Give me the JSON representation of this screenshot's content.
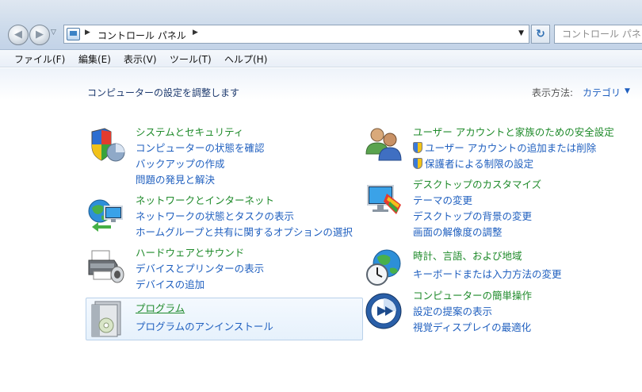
{
  "address_bar": {
    "path": [
      "コントロール パネル"
    ],
    "search_placeholder": "コントロール パネ"
  },
  "menu": [
    "ファイル(F)",
    "編集(E)",
    "表示(V)",
    "ツール(T)",
    "ヘルプ(H)"
  ],
  "header": {
    "title": "コンピューターの設定を調整します",
    "view_label": "表示方法:",
    "view_value": "カテゴリ"
  },
  "left_groups": [
    {
      "icon": "shield-icon",
      "title": "システムとセキュリティ",
      "links": [
        "コンピューターの状態を確認",
        "バックアップの作成",
        "問題の発見と解決"
      ]
    },
    {
      "icon": "network-icon",
      "title": "ネットワークとインターネット",
      "links": [
        "ネットワークの状態とタスクの表示",
        "ホームグループと共有に関するオプションの選択"
      ]
    },
    {
      "icon": "printer-icon",
      "title": "ハードウェアとサウンド",
      "links": [
        "デバイスとプリンターの表示",
        "デバイスの追加"
      ]
    },
    {
      "icon": "programs-icon",
      "title": "プログラム",
      "links": [
        "プログラムのアンインストール"
      ]
    }
  ],
  "right_groups": [
    {
      "icon": "users-icon",
      "title": "ユーザー アカウントと家族のための安全設定",
      "links": [
        "ユーザー アカウントの追加または削除",
        "保護者による制限の設定"
      ]
    },
    {
      "icon": "desktop-icon",
      "title": "デスクトップのカスタマイズ",
      "links": [
        "テーマの変更",
        "デスクトップの背景の変更",
        "画面の解像度の調整"
      ]
    },
    {
      "icon": "clock-globe-icon",
      "title": "時計、言語、および地域",
      "links": [
        "キーボードまたは入力方法の変更"
      ]
    },
    {
      "icon": "ease-of-access-icon",
      "title": "コンピューターの簡単操作",
      "links": [
        "設定の提案の表示",
        "視覚ディスプレイの最適化"
      ]
    }
  ],
  "colors": {
    "link": "#1f5fbf",
    "group_title": "#1e8a2a",
    "nav_bg": "#cddbeb"
  }
}
